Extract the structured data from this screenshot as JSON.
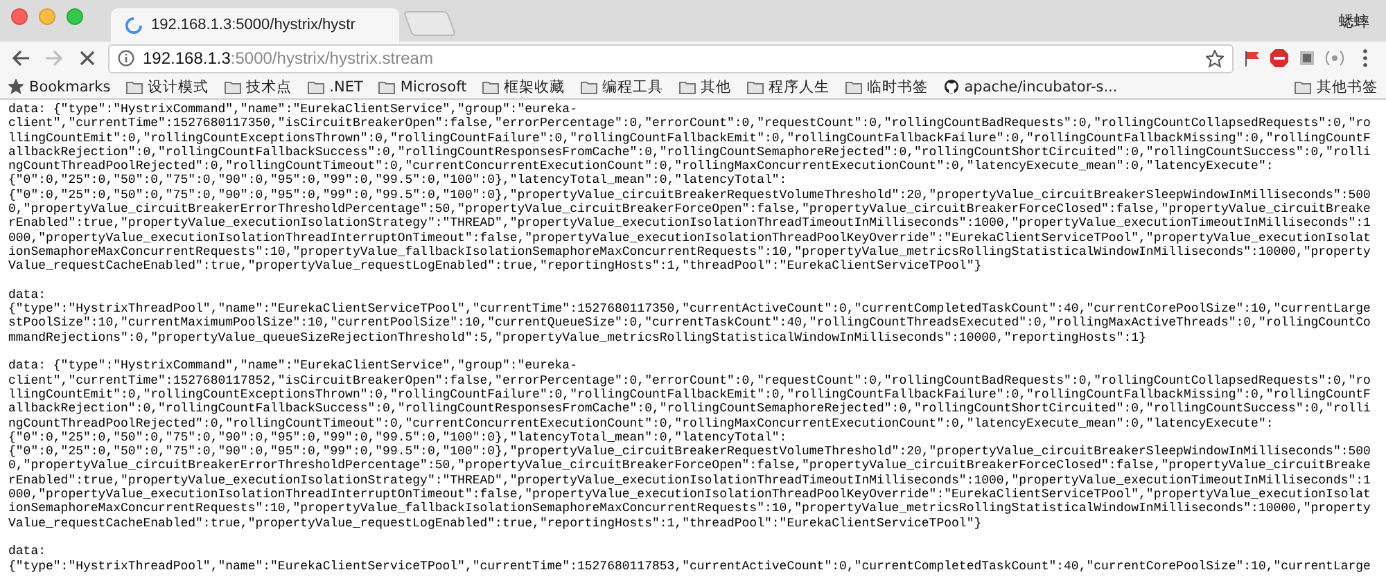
{
  "window": {
    "tab_title": "192.168.1.3:5000/hystrix/hystr",
    "loading": true,
    "profile_name": "蟋蟀"
  },
  "toolbar": {
    "back_disabled": false,
    "forward_disabled": true,
    "url_host": "192.168.1.3",
    "url_path": ":5000/hystrix/hystrix.stream"
  },
  "bookmarks": [
    {
      "label": "Bookmarks",
      "kind": "star"
    },
    {
      "label": "设计模式",
      "kind": "folder"
    },
    {
      "label": "技术点",
      "kind": "folder"
    },
    {
      "label": ".NET",
      "kind": "folder"
    },
    {
      "label": "Microsoft",
      "kind": "folder"
    },
    {
      "label": "框架收藏",
      "kind": "folder"
    },
    {
      "label": "编程工具",
      "kind": "folder"
    },
    {
      "label": "其他",
      "kind": "folder"
    },
    {
      "label": "程序人生",
      "kind": "folder"
    },
    {
      "label": "临时书签",
      "kind": "folder"
    },
    {
      "label": "apache/incubator-s...",
      "kind": "github"
    }
  ],
  "other_bookmarks": {
    "label": "其他书签"
  },
  "stream": [
    {
      "lines": [
        "data: {\"type\":\"HystrixCommand\",\"name\":\"EurekaClientService\",\"group\":\"eureka-",
        "client\",\"currentTime\":1527680117350,\"isCircuitBreakerOpen\":false,\"errorPercentage\":0,\"errorCount\":0,\"requestCount\":0,\"rollingCountBadRequests\":0,\"rollingCountCollapsedRequests\":0,\"ro",
        "llingCountEmit\":0,\"rollingCountExceptionsThrown\":0,\"rollingCountFailure\":0,\"rollingCountFallbackEmit\":0,\"rollingCountFallbackFailure\":0,\"rollingCountFallbackMissing\":0,\"rollingCountF",
        "allbackRejection\":0,\"rollingCountFallbackSuccess\":0,\"rollingCountResponsesFromCache\":0,\"rollingCountSemaphoreRejected\":0,\"rollingCountShortCircuited\":0,\"rollingCountSuccess\":0,\"rolli",
        "ngCountThreadPoolRejected\":0,\"rollingCountTimeout\":0,\"currentConcurrentExecutionCount\":0,\"rollingMaxConcurrentExecutionCount\":0,\"latencyExecute_mean\":0,\"latencyExecute\":",
        "{\"0\":0,\"25\":0,\"50\":0,\"75\":0,\"90\":0,\"95\":0,\"99\":0,\"99.5\":0,\"100\":0},\"latencyTotal_mean\":0,\"latencyTotal\":",
        "{\"0\":0,\"25\":0,\"50\":0,\"75\":0,\"90\":0,\"95\":0,\"99\":0,\"99.5\":0,\"100\":0},\"propertyValue_circuitBreakerRequestVolumeThreshold\":20,\"propertyValue_circuitBreakerSleepWindowInMilliseconds\":500",
        "0,\"propertyValue_circuitBreakerErrorThresholdPercentage\":50,\"propertyValue_circuitBreakerForceOpen\":false,\"propertyValue_circuitBreakerForceClosed\":false,\"propertyValue_circuitBreake",
        "rEnabled\":true,\"propertyValue_executionIsolationStrategy\":\"THREAD\",\"propertyValue_executionIsolationThreadTimeoutInMilliseconds\":1000,\"propertyValue_executionTimeoutInMilliseconds\":1",
        "000,\"propertyValue_executionIsolationThreadInterruptOnTimeout\":false,\"propertyValue_executionIsolationThreadPoolKeyOverride\":\"EurekaClientServiceTPool\",\"propertyValue_executionIsolat",
        "ionSemaphoreMaxConcurrentRequests\":10,\"propertyValue_fallbackIsolationSemaphoreMaxConcurrentRequests\":10,\"propertyValue_metricsRollingStatisticalWindowInMilliseconds\":10000,\"property",
        "Value_requestCacheEnabled\":true,\"propertyValue_requestLogEnabled\":true,\"reportingHosts\":1,\"threadPool\":\"EurekaClientServiceTPool\"}"
      ]
    },
    {
      "lines": [
        "data:",
        "{\"type\":\"HystrixThreadPool\",\"name\":\"EurekaClientServiceTPool\",\"currentTime\":1527680117350,\"currentActiveCount\":0,\"currentCompletedTaskCount\":40,\"currentCorePoolSize\":10,\"currentLarge",
        "stPoolSize\":10,\"currentMaximumPoolSize\":10,\"currentPoolSize\":10,\"currentQueueSize\":0,\"currentTaskCount\":40,\"rollingCountThreadsExecuted\":0,\"rollingMaxActiveThreads\":0,\"rollingCountCo",
        "mmandRejections\":0,\"propertyValue_queueSizeRejectionThreshold\":5,\"propertyValue_metricsRollingStatisticalWindowInMilliseconds\":10000,\"reportingHosts\":1}"
      ]
    },
    {
      "lines": [
        "data: {\"type\":\"HystrixCommand\",\"name\":\"EurekaClientService\",\"group\":\"eureka-",
        "client\",\"currentTime\":1527680117852,\"isCircuitBreakerOpen\":false,\"errorPercentage\":0,\"errorCount\":0,\"requestCount\":0,\"rollingCountBadRequests\":0,\"rollingCountCollapsedRequests\":0,\"ro",
        "llingCountEmit\":0,\"rollingCountExceptionsThrown\":0,\"rollingCountFailure\":0,\"rollingCountFallbackEmit\":0,\"rollingCountFallbackFailure\":0,\"rollingCountFallbackMissing\":0,\"rollingCountF",
        "allbackRejection\":0,\"rollingCountFallbackSuccess\":0,\"rollingCountResponsesFromCache\":0,\"rollingCountSemaphoreRejected\":0,\"rollingCountShortCircuited\":0,\"rollingCountSuccess\":0,\"rolli",
        "ngCountThreadPoolRejected\":0,\"rollingCountTimeout\":0,\"currentConcurrentExecutionCount\":0,\"rollingMaxConcurrentExecutionCount\":0,\"latencyExecute_mean\":0,\"latencyExecute\":",
        "{\"0\":0,\"25\":0,\"50\":0,\"75\":0,\"90\":0,\"95\":0,\"99\":0,\"99.5\":0,\"100\":0},\"latencyTotal_mean\":0,\"latencyTotal\":",
        "{\"0\":0,\"25\":0,\"50\":0,\"75\":0,\"90\":0,\"95\":0,\"99\":0,\"99.5\":0,\"100\":0},\"propertyValue_circuitBreakerRequestVolumeThreshold\":20,\"propertyValue_circuitBreakerSleepWindowInMilliseconds\":500",
        "0,\"propertyValue_circuitBreakerErrorThresholdPercentage\":50,\"propertyValue_circuitBreakerForceOpen\":false,\"propertyValue_circuitBreakerForceClosed\":false,\"propertyValue_circuitBreake",
        "rEnabled\":true,\"propertyValue_executionIsolationStrategy\":\"THREAD\",\"propertyValue_executionIsolationThreadTimeoutInMilliseconds\":1000,\"propertyValue_executionTimeoutInMilliseconds\":1",
        "000,\"propertyValue_executionIsolationThreadInterruptOnTimeout\":false,\"propertyValue_executionIsolationThreadPoolKeyOverride\":\"EurekaClientServiceTPool\",\"propertyValue_executionIsolat",
        "ionSemaphoreMaxConcurrentRequests\":10,\"propertyValue_fallbackIsolationSemaphoreMaxConcurrentRequests\":10,\"propertyValue_metricsRollingStatisticalWindowInMilliseconds\":10000,\"property",
        "Value_requestCacheEnabled\":true,\"propertyValue_requestLogEnabled\":true,\"reportingHosts\":1,\"threadPool\":\"EurekaClientServiceTPool\"}"
      ]
    },
    {
      "lines": [
        "data:",
        "{\"type\":\"HystrixThreadPool\",\"name\":\"EurekaClientServiceTPool\",\"currentTime\":1527680117853,\"currentActiveCount\":0,\"currentCompletedTaskCount\":40,\"currentCorePoolSize\":10,\"currentLarge"
      ]
    }
  ]
}
